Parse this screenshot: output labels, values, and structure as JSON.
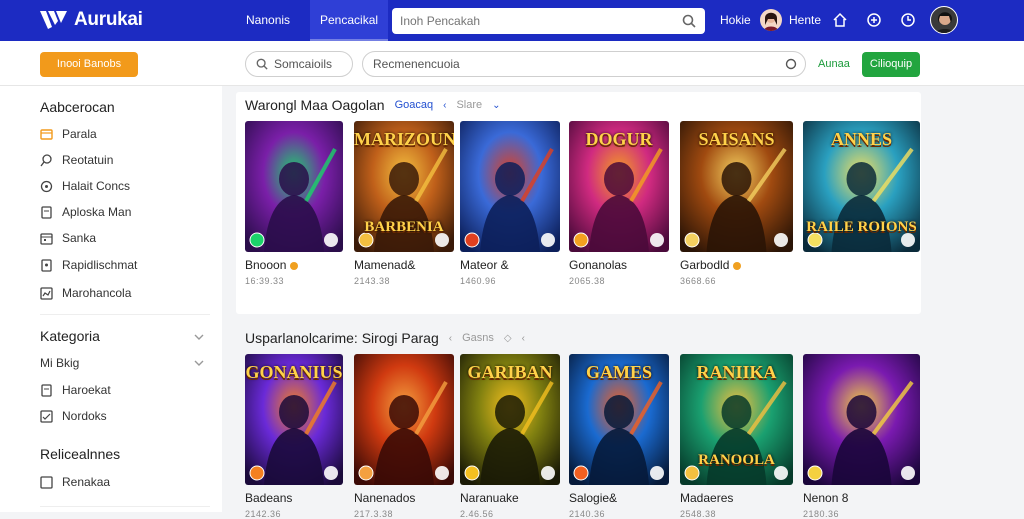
{
  "app": {
    "name": "Aurukai"
  },
  "topnav": {
    "links": [
      "Nanonis",
      "Pencacikal"
    ],
    "search_placeholder": "Inoh Pencakah",
    "right_links": [
      "Hokie",
      "Hente"
    ]
  },
  "subbar": {
    "orange_button": "Inooi Banobs",
    "filter_placeholder": "Somcaioils",
    "main_search_placeholder": "Recmenencuoia",
    "green_link": "Aunaa",
    "green_button": "Cilioquip"
  },
  "sidebar": {
    "section1_title": "Aabcerocan",
    "section1_items": [
      "Parala",
      "Reotatuin",
      "Halait Concs",
      "Aploska Man",
      "Sanka",
      "Rapidlischmat",
      "Marohancola"
    ],
    "section2_title": "Kategoria",
    "section2_items": [
      "Mi Bkig",
      "Haroekat",
      "Nordoks"
    ],
    "section3_title": "Relicealnnes",
    "section3_items": [
      "Renakaa"
    ]
  },
  "section1": {
    "title": "Warongl Maa Oagolan",
    "tab_active": "Goacaq",
    "tab_inactive": "Slare",
    "cards": [
      {
        "label": "Bnooon",
        "sub": "16:39.33",
        "badge": true
      },
      {
        "label": "Mamenad&",
        "sub": "2143.38",
        "badge": false
      },
      {
        "label": "Mateor &",
        "sub": "1460.96",
        "badge": false
      },
      {
        "label": "Gonanolas",
        "sub": "2065.38",
        "badge": false
      },
      {
        "label": "Garbodld",
        "sub": "3668.66",
        "badge": true
      },
      {
        "label": "",
        "sub": "",
        "badge": false
      }
    ],
    "art_titles": [
      "",
      "MARIZOUN",
      "",
      "DOGUR",
      "SAISANS",
      "ANNES"
    ],
    "art_subtitles": [
      "",
      "BARBENIA",
      "",
      "",
      "",
      "RAILE ROIONS"
    ]
  },
  "section2": {
    "title": "Usparlanolcarime: Sirogi Parag",
    "tab_inactive": "Gasns",
    "cards": [
      {
        "label": "Badeans",
        "sub": "2142.36",
        "badge": false
      },
      {
        "label": "Nanenados",
        "sub": "217.3.38",
        "badge": false
      },
      {
        "label": "Naranuake",
        "sub": "2.46.56",
        "badge": false
      },
      {
        "label": "Salogie&",
        "sub": "2140.36",
        "badge": false
      },
      {
        "label": "Madaeres",
        "sub": "2548.38",
        "badge": false
      },
      {
        "label": "Nenon 8",
        "sub": "2180.36",
        "badge": false
      }
    ],
    "art_titles": [
      "GONANIUS",
      "",
      "GARIBAN",
      "GAMES",
      "RANIIKA",
      ""
    ],
    "art_subtitles": [
      "",
      "",
      "",
      "",
      "RANOOLA",
      ""
    ]
  },
  "colors": {
    "topbar": "#1c2bc2",
    "accent_orange": "#f29a1b",
    "accent_green": "#22a53f",
    "link_blue": "#2350d0"
  }
}
